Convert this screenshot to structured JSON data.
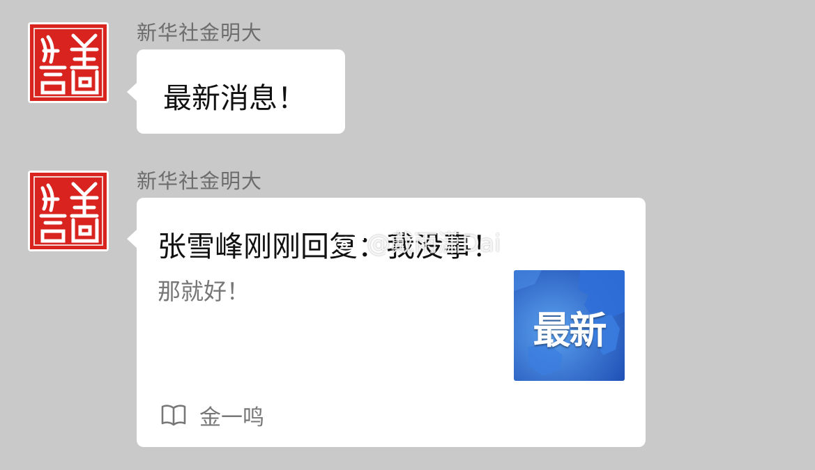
{
  "messages": [
    {
      "sender": "新华社金明大",
      "text": "最新消息！"
    },
    {
      "sender": "新华社金明大",
      "card": {
        "title": "张雪峰刚刚回复：我没事！",
        "description": "那就好！",
        "thumbnail_label": "最新",
        "source": "金一鸣",
        "source_icon": "book-icon"
      }
    }
  ],
  "avatar": {
    "icon": "red-seal-icon",
    "color": "#d8231f"
  },
  "watermark": {
    "text": "@戴雨潇Dai",
    "icon": "weibo-icon"
  },
  "colors": {
    "background": "#c9c9c9",
    "bubble": "#ffffff",
    "thumbnail_blue": "#1f5fc7"
  }
}
